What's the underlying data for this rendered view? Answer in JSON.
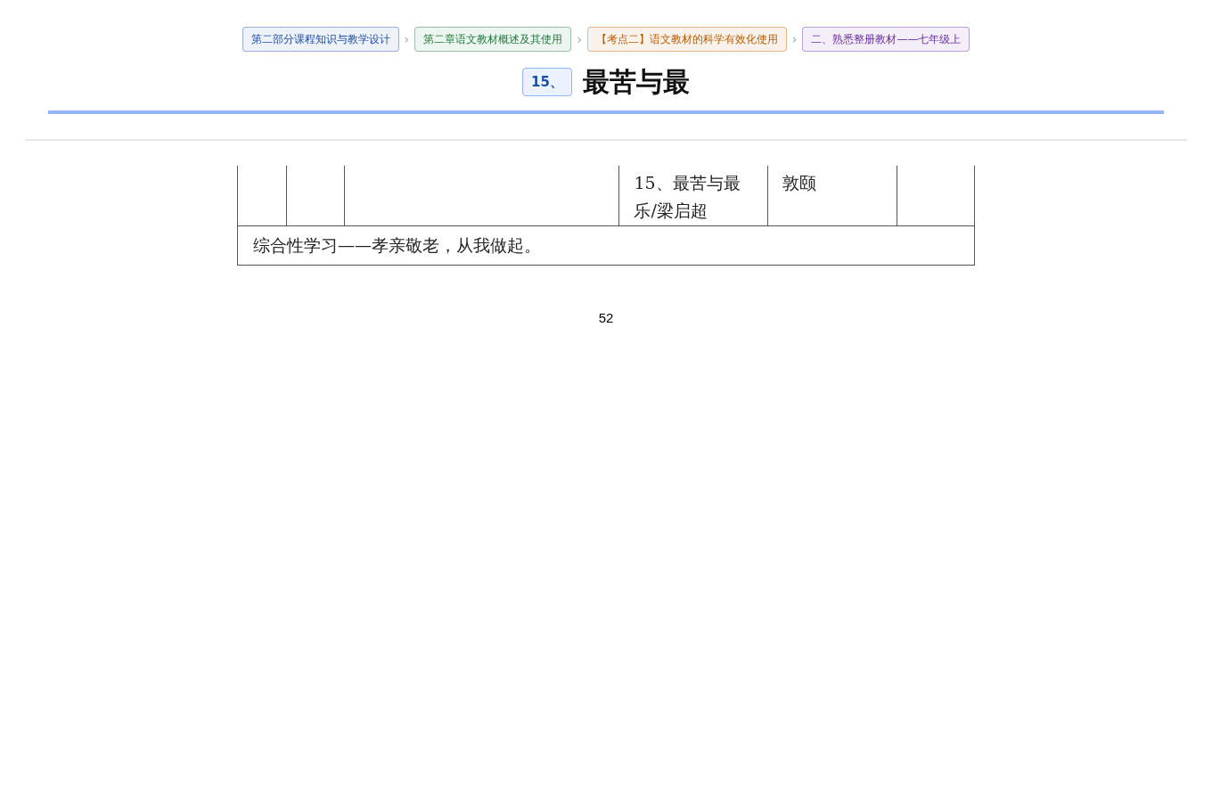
{
  "breadcrumbs": [
    {
      "label": "第二部分课程知识与教学设计",
      "color": "#1e4fa8"
    },
    {
      "label": "第二章语文教材概述及其使用",
      "color": "#1f7a3c"
    },
    {
      "label": "【考点二】语文教材的科学有效化使用",
      "color": "#b85c00"
    },
    {
      "label": "二、熟悉整册教材——七年级上",
      "color": "#6a2ca8"
    }
  ],
  "separator": "›",
  "title": {
    "number": "15、",
    "text": "最苦与最"
  },
  "table": {
    "rows": [
      {
        "kind": "cells",
        "cells": [
          "",
          "",
          "",
          "15、最苦与最乐/梁启超",
          "敦颐",
          ""
        ]
      },
      {
        "kind": "span",
        "text": "综合性学习——孝亲敬老，从我做起。"
      }
    ]
  },
  "page_number": "52"
}
